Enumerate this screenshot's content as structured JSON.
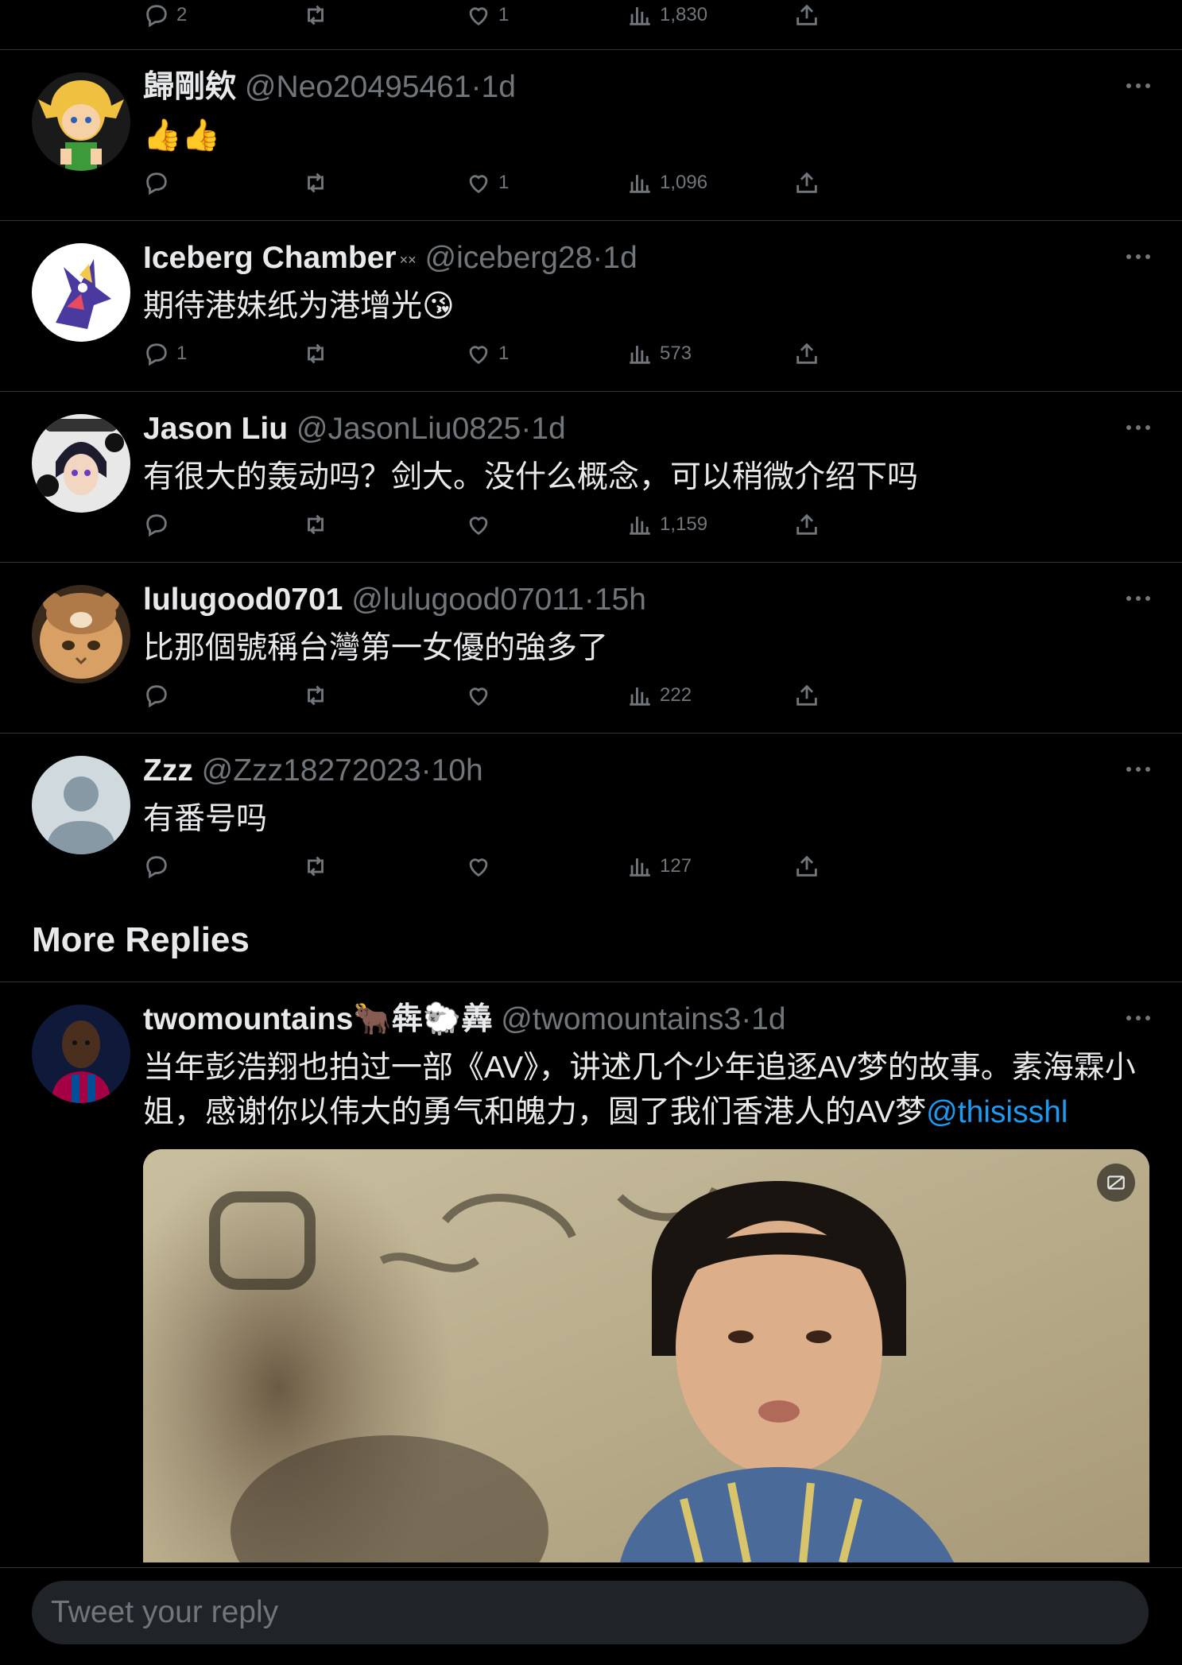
{
  "top_actions": {
    "reply_count": "2",
    "like_count": "1",
    "view_count": "1,830"
  },
  "replies": [
    {
      "name": "歸剛欸",
      "badge": "",
      "handle": "@Neo20495461",
      "time": "1d",
      "text": "👍👍",
      "reply_count": "",
      "like_count": "1",
      "view_count": "1,096",
      "avatar_icon": "link-avatar"
    },
    {
      "name": "Iceberg Chamber",
      "badge": "××",
      "handle": "@iceberg28",
      "time": "1d",
      "text": "期待港妹纸为港增光😘",
      "reply_count": "1",
      "like_count": "1",
      "view_count": "573",
      "avatar_icon": "character-avatar"
    },
    {
      "name": "Jason Liu",
      "badge": "",
      "handle": "@JasonLiu0825",
      "time": "1d",
      "text": "有很大的轰动吗？剑大。没什么概念，可以稍微介绍下吗",
      "reply_count": "",
      "like_count": "",
      "view_count": "1,159",
      "avatar_icon": "anime-avatar"
    },
    {
      "name": "lulugood0701",
      "badge": "",
      "handle": "@lulugood07011",
      "time": "15h",
      "text": "比那個號稱台灣第一女優的強多了",
      "reply_count": "",
      "like_count": "",
      "view_count": "222",
      "avatar_icon": "cat-avatar"
    },
    {
      "name": "Zzz",
      "badge": "",
      "handle": "@Zzz18272023",
      "time": "10h",
      "text": "有番号吗",
      "reply_count": "",
      "like_count": "",
      "view_count": "127",
      "avatar_icon": "default-avatar"
    }
  ],
  "more_replies": {
    "title": "More Replies",
    "tweet": {
      "name": "twomountains🐂犇🐑羴",
      "handle": "@twomountains3",
      "time": "1d",
      "text": "当年彭浩翔也拍过一部《AV》，讲述几个少年追逐AV梦的故事。素海霖小姐，感谢你以伟大的勇气和魄力，圆了我们香港人的AV梦",
      "mention": "@thisisshl"
    }
  },
  "reply_bar": {
    "placeholder": "Tweet your reply"
  },
  "colors": {
    "background": "#000000",
    "text": "#e7e9ea",
    "secondary": "#71767b",
    "accent": "#1d9bf0",
    "divider": "#2f3336"
  }
}
